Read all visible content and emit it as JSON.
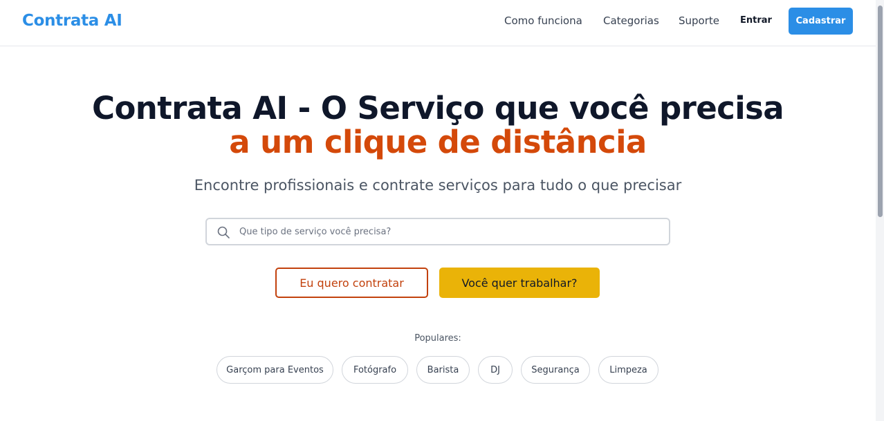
{
  "header": {
    "logo": "Contrata AI",
    "nav": {
      "como_funciona": "Como funciona",
      "categorias": "Categorias",
      "suporte": "Suporte"
    },
    "login_label": "Entrar",
    "signup_label": "Cadastrar"
  },
  "hero": {
    "title": "Contrata AI - O Serviço que você precisa",
    "highlight": "a um clique de distância",
    "subtitle": "Encontre profissionais e contrate serviços para tudo o que precisar"
  },
  "search": {
    "placeholder": "Que tipo de serviço você precisa?",
    "value": ""
  },
  "actions": {
    "hire_label": "Eu quero contratar",
    "work_label": "Você quer trabalhar?"
  },
  "popular": {
    "label": "Populares:",
    "items": [
      "Garçom para Eventos",
      "Fotógrafo",
      "Barista",
      "DJ",
      "Segurança",
      "Limpeza"
    ]
  },
  "colors": {
    "brand_blue": "#2b8ee6",
    "accent_orange": "#d4490a",
    "accent_yellow": "#eab308"
  }
}
